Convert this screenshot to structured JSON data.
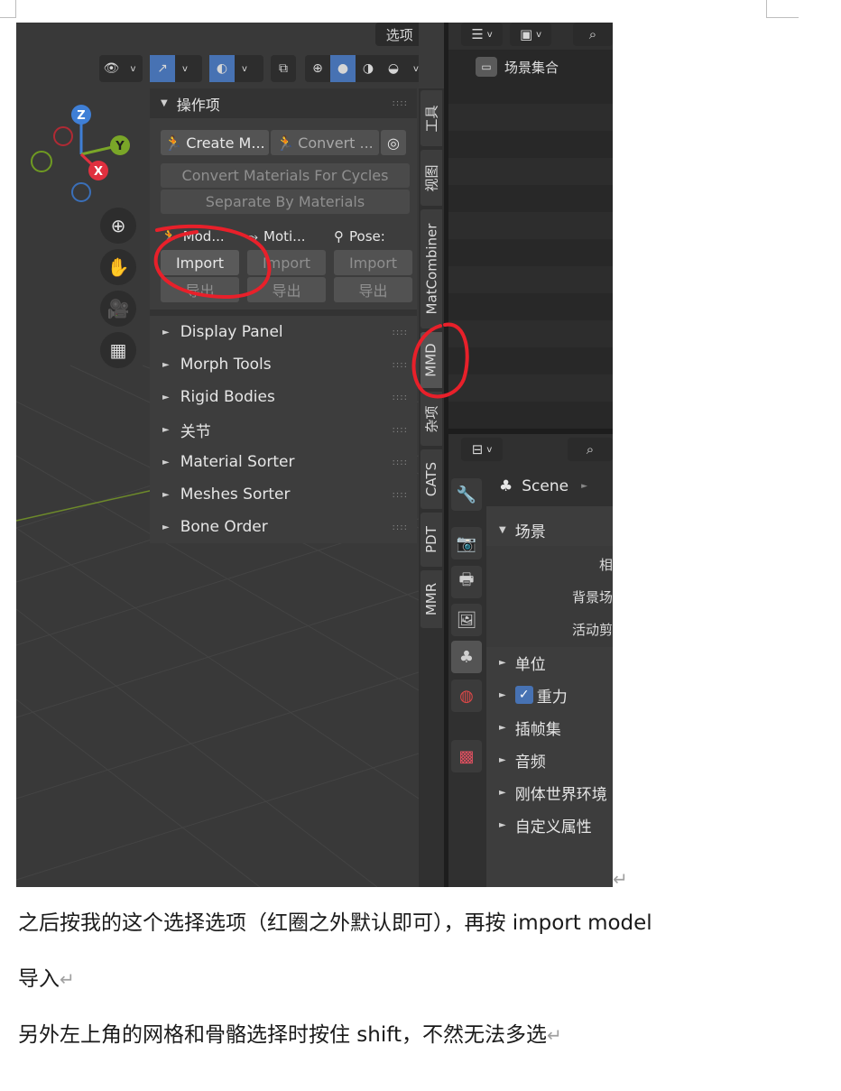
{
  "viewport": {
    "options_label": "选项",
    "gizmo_axes": [
      "Z",
      "Y",
      "X"
    ],
    "nav_icons": [
      "zoom-icon",
      "hand-icon",
      "camera-icon",
      "grid-icon"
    ]
  },
  "npanel": {
    "header": "操作项",
    "create_model": "Create M...",
    "convert": "Convert ...",
    "convert_materials": "Convert Materials For Cycles",
    "separate_by_materials": "Separate By Materials",
    "io_columns": [
      {
        "label": "Mod...",
        "import": "Import",
        "export": "导出"
      },
      {
        "label": "Moti...",
        "import": "Import",
        "export": "导出"
      },
      {
        "label": "Pose:",
        "import": "Import",
        "export": "导出"
      }
    ],
    "subpanels": [
      "Display Panel",
      "Morph Tools",
      "Rigid Bodies",
      "关节",
      "Material Sorter",
      "Meshes Sorter",
      "Bone Order"
    ]
  },
  "tabs": [
    "工具",
    "视图",
    "MatCombiner",
    "MMD",
    "杂项",
    "CATS",
    "PDT",
    "MMR"
  ],
  "outliner": {
    "scene_collection": "场景集合"
  },
  "properties": {
    "scene_label": "Scene",
    "section": "场景",
    "fields": [
      "相",
      "背景场",
      "活动剪"
    ],
    "subsections": [
      "单位",
      "重力",
      "插帧集",
      "音频",
      "刚体世界环境",
      "自定义属性"
    ]
  },
  "document": {
    "line1": "之后按我的这个选择选项（红圈之外默认即可），再按 import model",
    "line2": "导入",
    "line3": "另外左上角的网格和骨骼选择时按住 shift，不然无法多选"
  },
  "colors": {
    "accent": "#4772b3",
    "annotation": "#e8202a",
    "panel": "#3d3d3d",
    "viewport": "#393939"
  }
}
